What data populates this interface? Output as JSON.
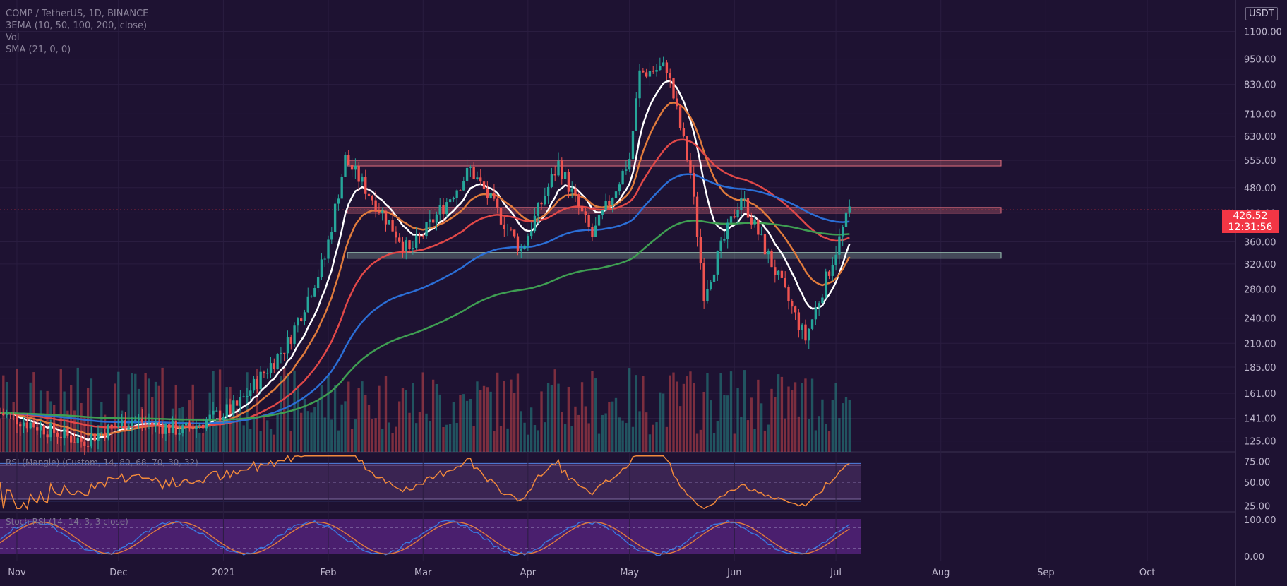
{
  "header": {
    "symbol": "COMP / TetherUS, 1D, BINANCE",
    "ind1": "3EMA (10, 50, 100, 200, close)",
    "ind2": "Vol",
    "ind3": "SMA (21, 0, 0)"
  },
  "price_scale": {
    "unit": "USDT",
    "current_price": "426.52",
    "countdown": "12:31:56"
  },
  "rsi": {
    "label": "RSI (Mangle) (Custom, 14, 80, 68, 70, 30, 32)"
  },
  "stoch": {
    "label": "Stoch RSI (14, 14, 3, 3 close)"
  },
  "colors": {
    "background": "#1e1232",
    "up": "#26a69a",
    "down": "#ef5350",
    "ema10": "#ffffff",
    "ema20": "#e07b3c",
    "ema50": "#e04848",
    "ema100": "#2b6ed6",
    "ema200": "#3f9e52",
    "resistance_zone": "#e26f7e",
    "support_zone": "#9fc9b6",
    "rsi_line": "#f1893c",
    "rsi_fill_high": "#8ac43f",
    "rsi_fill_low": "#e060a0",
    "stoch_k": "#3a78e0",
    "stoch_d": "#e07b3c"
  },
  "chart_data": {
    "type": "candlestick",
    "x_ticks": [
      "Nov",
      "Dec",
      "2021",
      "Feb",
      "Mar",
      "Apr",
      "May",
      "Jun",
      "Jul",
      "Aug",
      "Sep",
      "Oct"
    ],
    "y_ticks": [
      "1100.00",
      "950.00",
      "830.00",
      "710.00",
      "630.00",
      "555.00",
      "480.00",
      "420.00",
      "360.00",
      "320.00",
      "280.00",
      "240.00",
      "210.00",
      "185.00",
      "161.00",
      "141.00",
      "125.00"
    ],
    "rsi_ticks": [
      "75.00",
      "50.00",
      "25.00"
    ],
    "stoch_ticks": [
      "100.00",
      "0.00"
    ],
    "scale": "log",
    "ylim": [
      118,
      1300
    ],
    "zones": [
      {
        "type": "resistance",
        "low": 540,
        "high": 555
      },
      {
        "type": "resistance",
        "low": 420,
        "high": 432
      },
      {
        "type": "support",
        "low": 330,
        "high": 340
      }
    ],
    "key_points": [
      {
        "date": "2021-01-31",
        "price": 330
      },
      {
        "date": "2021-02-06",
        "price": 560
      },
      {
        "date": "2021-02-25",
        "price": 340
      },
      {
        "date": "2021-03-15",
        "price": 530
      },
      {
        "date": "2021-03-30",
        "price": 345
      },
      {
        "date": "2021-04-10",
        "price": 545
      },
      {
        "date": "2021-04-20",
        "price": 370
      },
      {
        "date": "2021-05-01",
        "price": 560
      },
      {
        "date": "2021-05-04",
        "price": 880
      },
      {
        "date": "2021-05-12",
        "price": 910
      },
      {
        "date": "2021-05-19",
        "price": 520
      },
      {
        "date": "2021-05-23",
        "price": 275
      },
      {
        "date": "2021-06-03",
        "price": 460
      },
      {
        "date": "2021-06-22",
        "price": 215
      },
      {
        "date": "2021-07-05",
        "price": 426.52
      }
    ]
  }
}
